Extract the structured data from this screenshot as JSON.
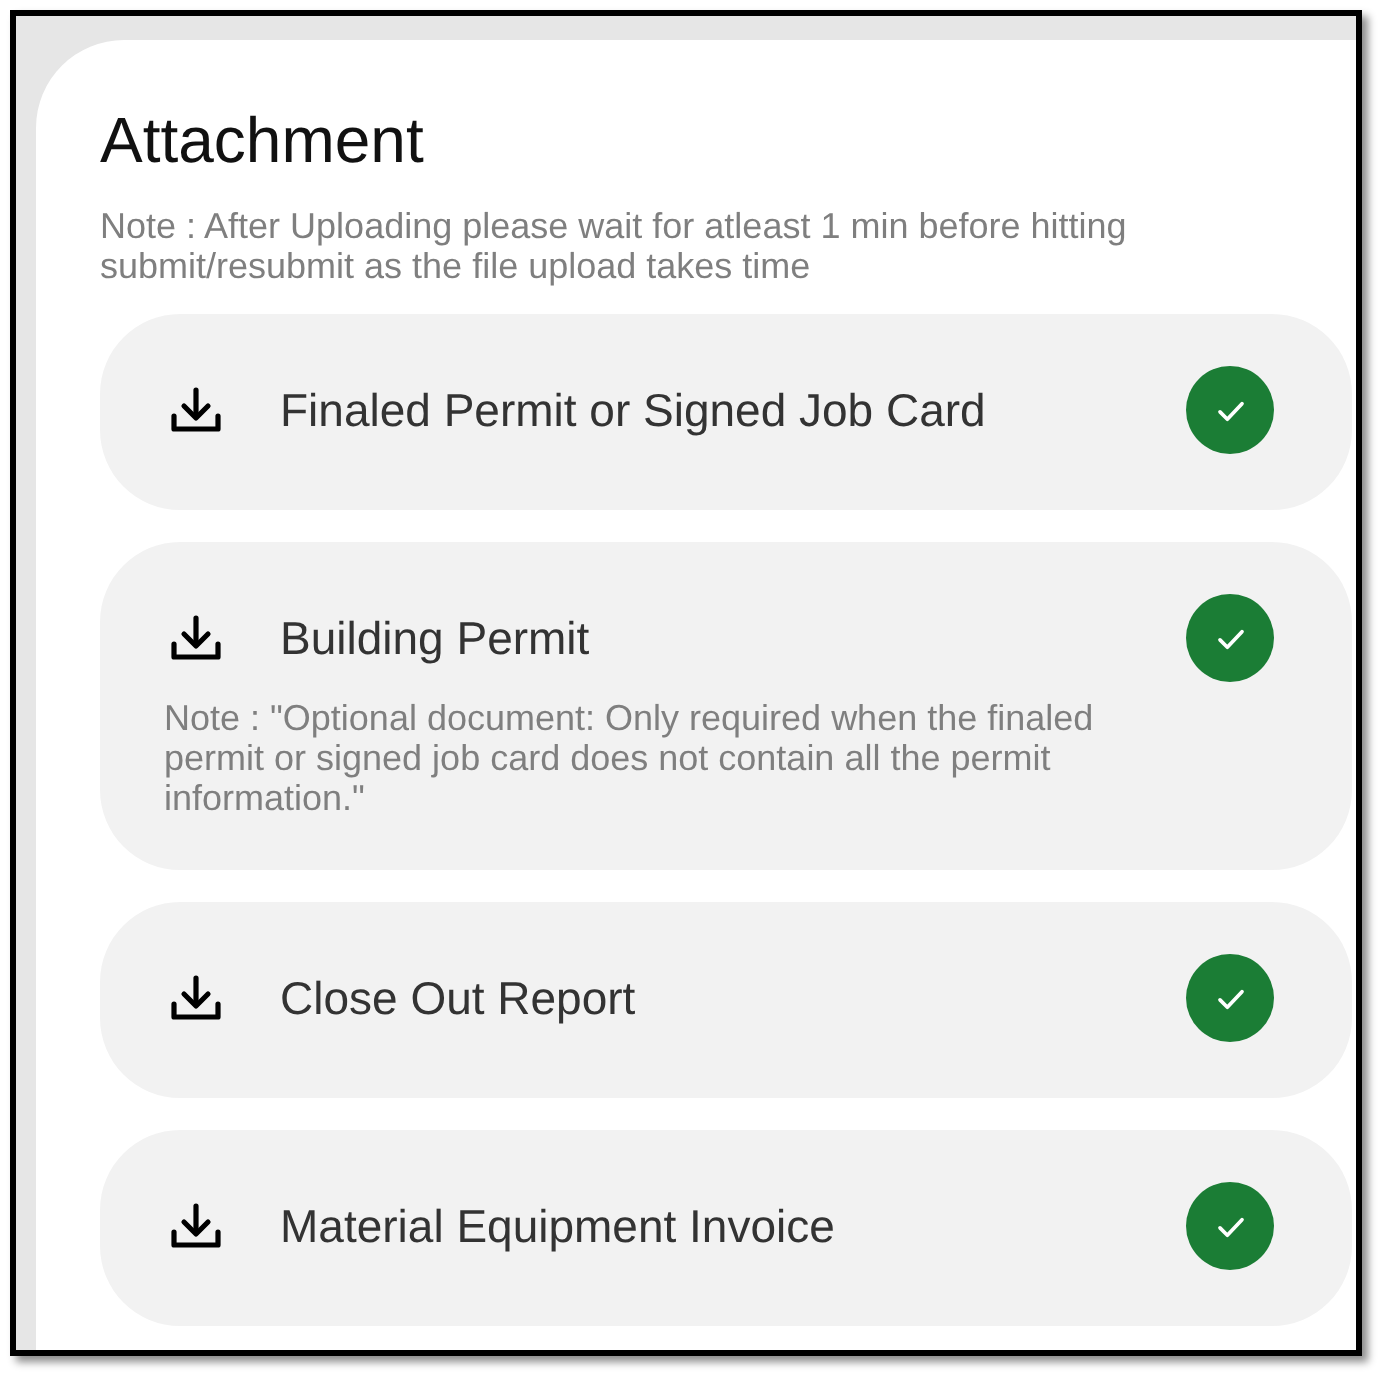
{
  "section": {
    "title": "Attachment",
    "note": "Note : After Uploading please wait for atleast 1 min before hitting submit/resubmit as the file upload takes time"
  },
  "attachments": [
    {
      "label": "Finaled Permit or Signed Job Card",
      "uploaded": true
    },
    {
      "label": "Building Permit",
      "uploaded": true,
      "note": "Note : \"Optional document: Only required when the finaled permit or signed job card does not contain all the permit information.\""
    },
    {
      "label": "Close Out Report",
      "uploaded": true
    },
    {
      "label": "Material Equipment Invoice",
      "uploaded": true
    }
  ]
}
